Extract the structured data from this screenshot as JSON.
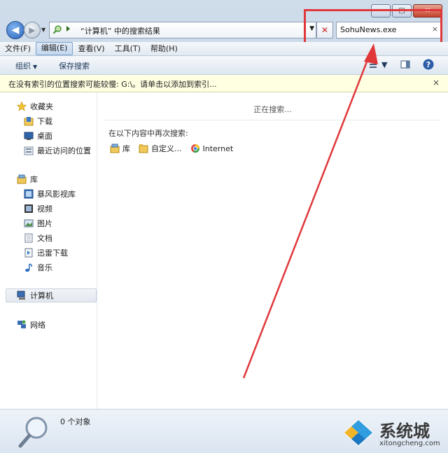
{
  "window": {
    "caption_buttons": {
      "minimize": "—",
      "maximize": "□",
      "close": "✕"
    }
  },
  "address": {
    "text": "“计算机” 中的搜索结果",
    "dropdown": "▼",
    "stop": "✕"
  },
  "search": {
    "value": "SohuNews.exe",
    "clear": "×"
  },
  "menu": [
    "文件(F)",
    "编辑(E)",
    "查看(V)",
    "工具(T)",
    "帮助(H)"
  ],
  "toolbar": {
    "organize": "组织",
    "save_search": "保存搜索",
    "caret": "▼"
  },
  "infobar": {
    "text": "在没有索引的位置搜索可能较慢: G:\\。请单击以添加到索引...",
    "close": "×"
  },
  "nav": {
    "favorites": "收藏夹",
    "downloads": "下载",
    "desktop": "桌面",
    "recent": "最近访问的位置",
    "libraries": "库",
    "baofeng": "暴风影视库",
    "videos": "视频",
    "pictures": "图片",
    "documents": "文档",
    "xunlei": "迅雷下载",
    "music": "音乐",
    "computer": "计算机",
    "network": "网络"
  },
  "main": {
    "searching": "正在搜索...",
    "search_again": "在以下内容中再次搜索:",
    "library": "库",
    "custom": "自定义...",
    "internet": "Internet"
  },
  "status": {
    "count": "0 个对象"
  },
  "watermark": {
    "title": "系统城",
    "site": "xitongcheng.com"
  },
  "colors": {
    "highlight": "#e0383a",
    "accent": "#2a62b8",
    "infobar": "#ffffe1"
  }
}
